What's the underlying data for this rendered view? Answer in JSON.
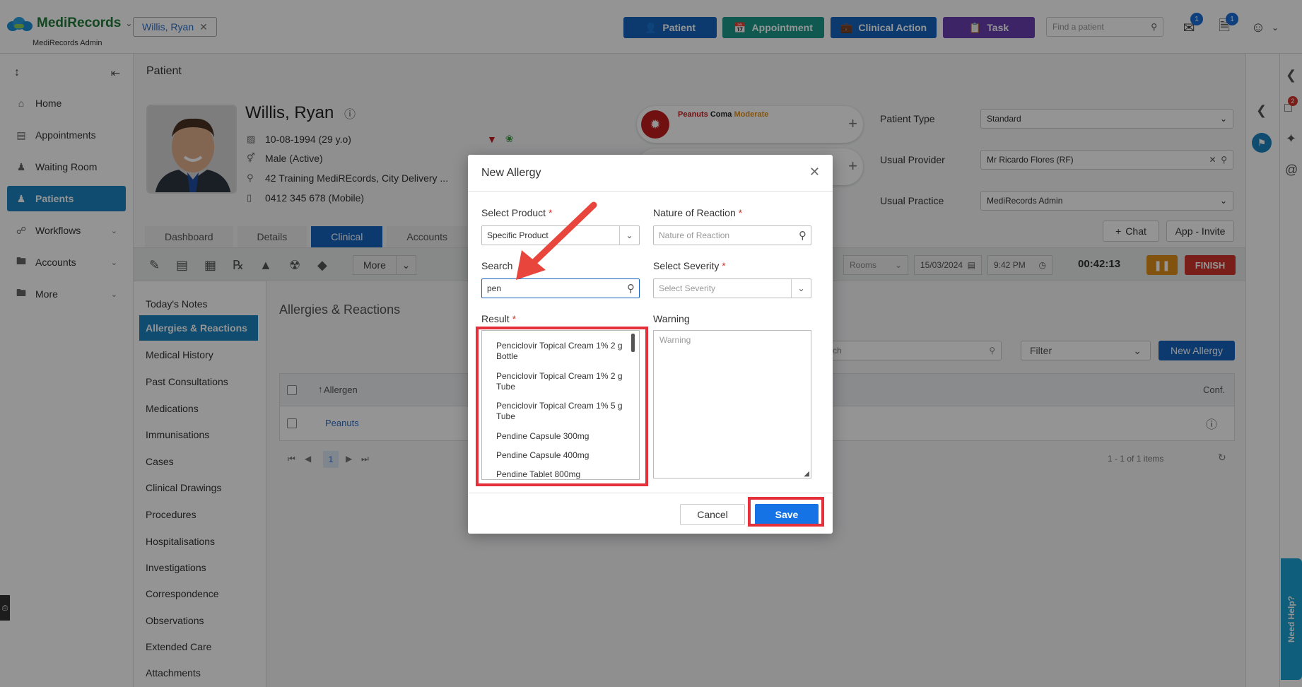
{
  "app": {
    "name": "MediRecords",
    "subtitle": "MediRecords Admin"
  },
  "header": {
    "patient_chip": "Willis, Ryan",
    "buttons": [
      {
        "label": "Patient",
        "color": "#1565c0"
      },
      {
        "label": "Appointment",
        "color": "#1a9a8a"
      },
      {
        "label": "Clinical Action",
        "color": "#1565c0"
      },
      {
        "label": "Task",
        "color": "#6a3fb0"
      }
    ],
    "find_placeholder": "Find a patient",
    "mail_badge": "1",
    "tasks_badge": "1"
  },
  "sidebar": {
    "items": [
      {
        "label": "Home",
        "icon": "home-icon"
      },
      {
        "label": "Appointments",
        "icon": "calendar-icon"
      },
      {
        "label": "Waiting Room",
        "icon": "users-icon"
      },
      {
        "label": "Patients",
        "icon": "user-icon",
        "active": true
      },
      {
        "label": "Workflows",
        "icon": "workflow-icon"
      },
      {
        "label": "Accounts",
        "icon": "folder-icon"
      },
      {
        "label": "More",
        "icon": "folder-icon"
      }
    ]
  },
  "main": {
    "title": "Patient",
    "patient": {
      "name": "Willis, Ryan",
      "dob": "10-08-1994 (29 y.o)",
      "gender": "Male (Active)",
      "address": "42 Training MediREcords, City Delivery ...",
      "phone": "0412 345 678 (Mobile)"
    },
    "allergy_alert": {
      "allergen": "Peanuts",
      "reaction": "Coma",
      "severity": "Moderate"
    },
    "fields": {
      "patient_type_label": "Patient Type",
      "patient_type_value": "Standard",
      "usual_provider_label": "Usual Provider",
      "usual_provider_value": "Mr Ricardo Flores (RF)",
      "usual_practice_label": "Usual Practice",
      "usual_practice_value": "MediRecords Admin"
    },
    "tabs": [
      "Dashboard",
      "Details",
      "Clinical",
      "Accounts"
    ],
    "chat_label": "Chat",
    "app_invite_label": "App - Invite",
    "toolbar": {
      "more_label": "More",
      "rooms_placeholder": "Rooms",
      "date": "15/03/2024",
      "time": "9:42 PM",
      "timer": "00:42:13",
      "finish_label": "FINISH"
    },
    "clinical_nav": [
      "Today's Notes",
      "Allergies & Reactions",
      "Medical History",
      "Past Consultations",
      "Medications",
      "Immunisations",
      "Cases",
      "Clinical Drawings",
      "Procedures",
      "Hospitalisations",
      "Investigations",
      "Correspondence",
      "Observations",
      "Extended Care",
      "Attachments"
    ],
    "content_title": "Allergies & Reactions",
    "grid": {
      "search_placeholder": "ch",
      "filter_placeholder": "Filter",
      "new_allergy_label": "New Allergy",
      "col_allergen": "Allergen",
      "col_conf": "Conf.",
      "rows": [
        {
          "allergen": "Peanuts"
        }
      ],
      "page": "1",
      "items_text": "1 - 1 of 1 items"
    }
  },
  "modal": {
    "title": "New Allergy",
    "select_product_label": "Select Product",
    "select_product_value": "Specific Product",
    "nature_label": "Nature of Reaction",
    "nature_placeholder": "Nature of Reaction",
    "search_label": "Search",
    "search_value": "pen",
    "severity_label": "Select Severity",
    "severity_placeholder": "Select Severity",
    "result_label": "Result",
    "warning_label": "Warning",
    "warning_placeholder": "Warning",
    "results": [
      "Penciclovir Topical Cream 1% 2 g Bottle",
      "Penciclovir Topical Cream 1% 2 g Tube",
      "Penciclovir Topical Cream 1% 5 g Tube",
      "Pendine Capsule 300mg",
      "Pendine Capsule 400mg",
      "Pendine Tablet 800mg"
    ],
    "cancel_label": "Cancel",
    "save_label": "Save"
  },
  "help_label": "Need Help?",
  "rail_badge": "2"
}
